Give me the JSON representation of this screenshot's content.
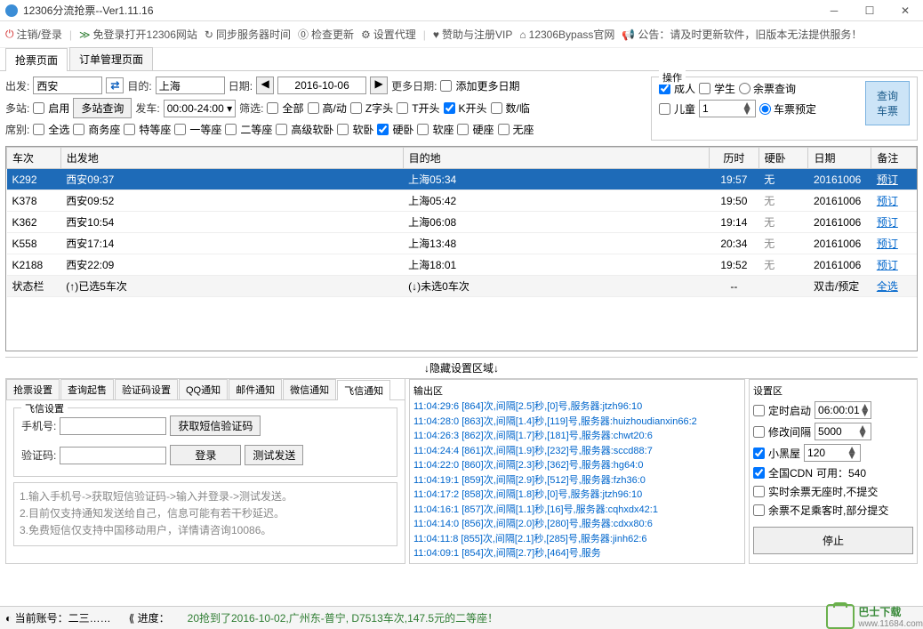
{
  "window": {
    "title": "12306分流抢票--Ver1.11.16"
  },
  "toolbar": {
    "logout": "注销/登录",
    "open_site": "免登录打开12306网站",
    "sync_time": "同步服务器时间",
    "check_update": "检查更新",
    "set_proxy": "设置代理",
    "sponsor": "赞助与注册VIP",
    "bypass": "12306Bypass官网",
    "announce": "公告：请及时更新软件，旧版本无法提供服务！"
  },
  "main_tabs": {
    "grab": "抢票页面",
    "orders": "订单管理页面"
  },
  "search": {
    "depart_label": "出发:",
    "depart_value": "西安",
    "dest_label": "目的:",
    "dest_value": "上海",
    "date_label": "日期:",
    "date_value": "2016-10-06",
    "more_date_label": "更多日期:",
    "add_more_date": "添加更多日期",
    "multi_label": "多站:",
    "enable": "启用",
    "multi_query": "多站查询",
    "depart_time_label": "发车:",
    "depart_time": "00:00-24:00",
    "filter_label": "筛选:",
    "filters": {
      "all": "全部",
      "gaodong": "高/动",
      "z": "Z字头",
      "t": "T开头",
      "k": "K开头",
      "num": "数/临"
    },
    "seat_label": "席别:",
    "seats": {
      "all": "全选",
      "business": "商务座",
      "special": "特等座",
      "first": "一等座",
      "second": "二等座",
      "soft_sleeper_adv": "高级软卧",
      "soft_sleeper": "软卧",
      "hard_sleeper": "硬卧",
      "soft_seat": "软座",
      "hard_seat": "硬座",
      "no_seat": "无座"
    }
  },
  "ops": {
    "title": "操作",
    "adult": "成人",
    "student": "学生",
    "child": "儿童",
    "child_count": "1",
    "remain_query": "余票查询",
    "ticket_book": "车票预定",
    "query_btn": "查询\n车票"
  },
  "table": {
    "headers": {
      "train": "车次",
      "depart": "出发地",
      "dest": "目的地",
      "duration": "历时",
      "seat": "硬卧",
      "date": "日期",
      "note": "备注"
    },
    "rows": [
      {
        "train": "K292",
        "depart": "西安09:37",
        "dest": "上海05:34",
        "duration": "19:57",
        "seat": "无",
        "date": "20161006",
        "note": "预订",
        "selected": true
      },
      {
        "train": "K378",
        "depart": "西安09:52",
        "dest": "上海05:42",
        "duration": "19:50",
        "seat": "无",
        "date": "20161006",
        "note": "预订"
      },
      {
        "train": "K362",
        "depart": "西安10:54",
        "dest": "上海06:08",
        "duration": "19:14",
        "seat": "无",
        "date": "20161006",
        "note": "预订"
      },
      {
        "train": "K558",
        "depart": "西安17:14",
        "dest": "上海13:48",
        "duration": "20:34",
        "seat": "无",
        "date": "20161006",
        "note": "预订"
      },
      {
        "train": "K2188",
        "depart": "西安22:09",
        "dest": "上海18:01",
        "duration": "19:52",
        "seat": "无",
        "date": "20161006",
        "note": "预订"
      }
    ],
    "status": {
      "label": "状态栏",
      "selected": "(↑)已选5车次",
      "unselected": "(↓)未选0车次",
      "dash": "--",
      "action": "双击/预定",
      "select_all": "全选"
    }
  },
  "hide_settings": "↓隐藏设置区域↓",
  "sub_tabs": {
    "grab_setting": "抢票设置",
    "query_start": "查询起售",
    "captcha": "验证码设置",
    "qq": "QQ通知",
    "mail": "邮件通知",
    "wechat": "微信通知",
    "fetion": "飞信通知"
  },
  "fetion": {
    "title": "飞信设置",
    "phone_label": "手机号:",
    "get_code": "获取短信验证码",
    "code_label": "验证码:",
    "login": "登录",
    "test_send": "测试发送",
    "help1": "1.输入手机号->获取短信验证码->输入并登录->测试发送。",
    "help2": "2.目前仅支持通知发送给自己，信息可能有若干秒延迟。",
    "help3": "3.免费短信仅支持中国移动用户，详情请咨询10086。"
  },
  "output": {
    "title": "输出区",
    "lines": [
      "11:04:29:6   [864]次,间隔[2.5]秒,[0]号,服务器:jtzh96:10",
      "11:04:28:0   [863]次,间隔[1.4]秒,[119]号,服务器:huizhoudianxin66:2",
      "11:04:26:3   [862]次,间隔[1.7]秒,[181]号,服务器:chwt20:6",
      "11:04:24:4   [861]次,间隔[1.9]秒,[232]号,服务器:sccd88:7",
      "11:04:22:0   [860]次,间隔[2.3]秒,[362]号,服务器:hg64:0",
      "11:04:19:1   [859]次,间隔[2.9]秒,[512]号,服务器:fzh36:0",
      "11:04:17:2   [858]次,间隔[1.8]秒,[0]号,服务器:jtzh96:10",
      "11:04:16:1   [857]次,间隔[1.1]秒,[16]号,服务器:cqhxdx42:1",
      "11:04:14:0   [856]次,间隔[2.0]秒,[280]号,服务器:cdxx80:6",
      "11:04:11:8   [855]次,间隔[2.1]秒,[285]号,服务器:jinh62:6",
      "11:04:09:1   [854]次,间隔[2.7]秒,[464]号,服务"
    ]
  },
  "settings": {
    "title": "设置区",
    "timer_start": "定时启动",
    "timer_value": "06:00:01",
    "change_interval": "修改间隔",
    "interval_value": "5000",
    "blacklist": "小黑屋",
    "blacklist_value": "120",
    "cdn": "全国CDN",
    "cdn_avail": "可用：540",
    "realtime": "实时余票无座时,不提交",
    "insufficient": "余票不足乘客时,部分提交",
    "stop": "停止"
  },
  "statusbar": {
    "account_label": "当前账号：",
    "account": "二三……",
    "progress_label": "进度：",
    "msg": "20抢到了2016-10-02,广州东-普宁, D7513车次,147.5元的二等座！"
  },
  "watermark": {
    "text": "巴士下载",
    "url": "www.11684.com"
  }
}
